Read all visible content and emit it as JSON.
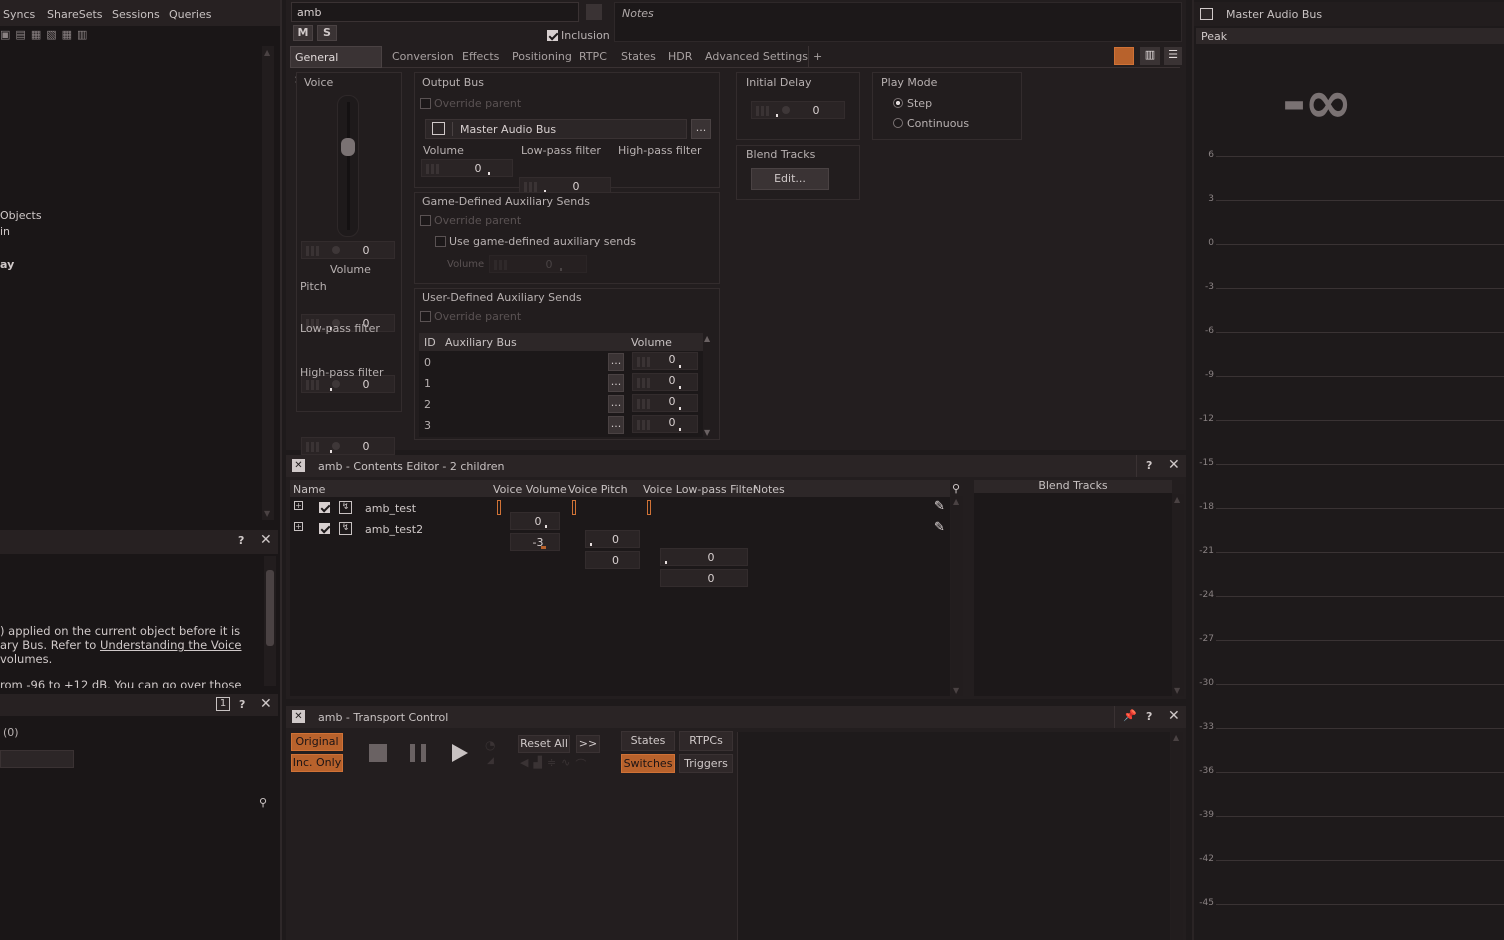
{
  "left_top_tabs": [
    "Syncs",
    "ShareSets",
    "Sessions",
    "Queries"
  ],
  "left_tree": [
    "Objects",
    "in",
    "ay"
  ],
  "left_help": {
    "line1": ") applied on the current object before it is",
    "line2_pre": "ary Bus. Refer to ",
    "line2_link": "Understanding the Voice",
    "line3": " volumes.",
    "line4": "rom -96 to +12 dB. You can go over those"
  },
  "left_lower": {
    "count_badge": "1",
    "count_label": "(0)"
  },
  "object": {
    "name": "amb",
    "mute": "M",
    "solo": "S",
    "inclusion_label": "Inclusion",
    "notes_placeholder": "Notes"
  },
  "tabs": [
    "General Settings",
    "Conversion",
    "Effects",
    "Positioning",
    "RTPC",
    "States",
    "HDR",
    "Advanced Settings",
    "+"
  ],
  "voice": {
    "title": "Voice",
    "volume_value": "0",
    "volume_label": "Volume",
    "pitch_label": "Pitch",
    "pitch_value": "0",
    "lpf_label": "Low-pass filter",
    "lpf_value": "0",
    "hpf_label": "High-pass filter",
    "hpf_value": "0",
    "slider_fraction": 0.5
  },
  "output_bus": {
    "title": "Output Bus",
    "override_parent": "Override parent",
    "bus_name": "Master Audio Bus",
    "more": "...",
    "volume_label": "Volume",
    "volume_value": "0",
    "lpf_label": "Low-pass filter",
    "lpf_value": "0",
    "hpf_label": "High-pass filter",
    "hpf_value": "0"
  },
  "game_sends": {
    "title": "Game-Defined Auxiliary Sends",
    "override_parent": "Override parent",
    "use_label": "Use game-defined auxiliary sends",
    "volume_label": "Volume",
    "volume_value": "0"
  },
  "user_sends": {
    "title": "User-Defined Auxiliary Sends",
    "override_parent": "Override parent",
    "col_id": "ID",
    "col_bus": "Auxiliary Bus",
    "col_volume": "Volume",
    "rows": [
      {
        "id": "0",
        "more": "...",
        "volume": "0"
      },
      {
        "id": "1",
        "more": "...",
        "volume": "0"
      },
      {
        "id": "2",
        "more": "...",
        "volume": "0"
      },
      {
        "id": "3",
        "more": "...",
        "volume": "0"
      }
    ]
  },
  "initial_delay": {
    "title": "Initial Delay",
    "value": "0"
  },
  "blend_tracks": {
    "title": "Blend Tracks",
    "edit_label": "Edit..."
  },
  "play_mode": {
    "title": "Play Mode",
    "step": "Step",
    "continuous": "Continuous",
    "selected": "Step"
  },
  "contents_editor": {
    "title": "amb - Contents Editor - 2 children",
    "columns": [
      "Name",
      "Voice Volume",
      "Voice Pitch",
      "Voice Low-pass Filter",
      "Notes"
    ],
    "rows": [
      {
        "name": "amb_test",
        "volume": "0",
        "pitch": "0",
        "lpf": "0"
      },
      {
        "name": "amb_test2",
        "volume": "-3",
        "pitch": "0",
        "lpf": "0"
      }
    ],
    "blend_tracks_header": "Blend Tracks"
  },
  "transport": {
    "title": "amb - Transport Control",
    "original": "Original",
    "inc_only": "Inc. Only",
    "reset_all": "Reset All",
    "more": ">>",
    "states": "States",
    "rtpcs": "RTPCs",
    "switches": "Switches",
    "triggers": "Triggers"
  },
  "meter": {
    "title": "Master Audio Bus",
    "mode": "Peak",
    "readout": "-∞",
    "scale": [
      "6",
      "3",
      "0",
      "-3",
      "-6",
      "-9",
      "-12",
      "-15",
      "-18",
      "-21",
      "-24",
      "-27",
      "-30",
      "-33",
      "-36",
      "-39",
      "-42",
      "-45"
    ]
  },
  "colors": {
    "accent": "#b8622c",
    "bg": "#1e1a1b",
    "panel": "#231e1f"
  }
}
